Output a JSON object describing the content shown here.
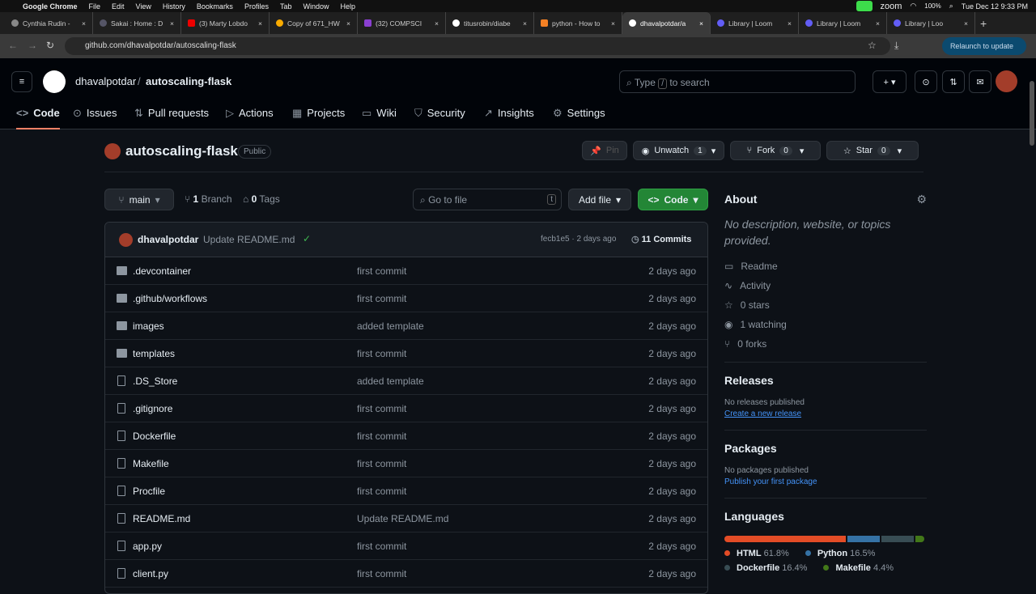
{
  "menubar": {
    "app": "Google Chrome",
    "items": [
      "File",
      "Edit",
      "View",
      "History",
      "Bookmarks",
      "Profiles",
      "Tab",
      "Window",
      "Help"
    ],
    "status": "zoom",
    "battery": "100%",
    "datetime": "Tue Dec 12  9:33 PM"
  },
  "tabs": [
    "Cynthia Rudin -",
    "Sakai : Home : D",
    "(3) Marty Lobdo",
    "Copy of 671_HW",
    "(32) COMPSCI",
    "titusrobin/diabe",
    "python - How to",
    "dhavalpotdar/a",
    "Library | Loom",
    "Library | Loom",
    "Library | Loo"
  ],
  "address": {
    "url": "github.com/dhavalpotdar/autoscaling-flask",
    "relaunch": "Relaunch to update"
  },
  "header": {
    "owner": "dhavalpotdar",
    "sep": "/",
    "repo": "autoscaling-flask",
    "search_pre": "Type",
    "search_key": "/",
    "search_post": "to search"
  },
  "nav": [
    "Code",
    "Issues",
    "Pull requests",
    "Actions",
    "Projects",
    "Wiki",
    "Security",
    "Insights",
    "Settings"
  ],
  "repo": {
    "name": "autoscaling-flask",
    "visibility": "Public",
    "pin": "Pin",
    "unwatch": "Unwatch",
    "watch_count": "1",
    "fork": "Fork",
    "fork_count": "0",
    "star": "Star",
    "star_count": "0"
  },
  "toolbar": {
    "branch": "main",
    "branches": "1",
    "branches_label": "Branch",
    "tags": "0",
    "tags_label": "Tags",
    "goto": "Go to file",
    "goto_key": "t",
    "add_file": "Add file",
    "code": "Code"
  },
  "commit": {
    "author": "dhavalpotdar",
    "message": "Update README.md",
    "hash": "fecb1e5 · 2 days ago",
    "commits": "11 Commits"
  },
  "files": [
    {
      "name": ".devcontainer",
      "type": "folder",
      "msg": "first commit",
      "date": "2 days ago"
    },
    {
      "name": ".github/workflows",
      "type": "folder",
      "msg": "first commit",
      "date": "2 days ago"
    },
    {
      "name": "images",
      "type": "folder",
      "msg": "added template",
      "date": "2 days ago"
    },
    {
      "name": "templates",
      "type": "folder",
      "msg": "first commit",
      "date": "2 days ago"
    },
    {
      "name": ".DS_Store",
      "type": "file",
      "msg": "added template",
      "date": "2 days ago"
    },
    {
      "name": ".gitignore",
      "type": "file",
      "msg": "first commit",
      "date": "2 days ago"
    },
    {
      "name": "Dockerfile",
      "type": "file",
      "msg": "first commit",
      "date": "2 days ago"
    },
    {
      "name": "Makefile",
      "type": "file",
      "msg": "first commit",
      "date": "2 days ago"
    },
    {
      "name": "Procfile",
      "type": "file",
      "msg": "first commit",
      "date": "2 days ago"
    },
    {
      "name": "README.md",
      "type": "file",
      "msg": "Update README.md",
      "date": "2 days ago"
    },
    {
      "name": "app.py",
      "type": "file",
      "msg": "first commit",
      "date": "2 days ago"
    },
    {
      "name": "client.py",
      "type": "file",
      "msg": "first commit",
      "date": "2 days ago"
    }
  ],
  "about": {
    "title": "About",
    "desc": "No description, website, or topics provided.",
    "items": [
      "Readme",
      "Activity",
      "0 stars",
      "1 watching",
      "0 forks"
    ]
  },
  "releases": {
    "title": "Releases",
    "none": "No releases published",
    "link": "Create a new release"
  },
  "packages": {
    "title": "Packages",
    "none": "No packages published",
    "link": "Publish your first package"
  },
  "languages": {
    "title": "Languages",
    "list": [
      {
        "name": "HTML",
        "pct": "61.8%",
        "value": 61.8,
        "color": "#e34c26"
      },
      {
        "name": "Python",
        "pct": "16.5%",
        "value": 16.5,
        "color": "#3572A5"
      },
      {
        "name": "Dockerfile",
        "pct": "16.4%",
        "value": 16.4,
        "color": "#384d54"
      },
      {
        "name": "Makefile",
        "pct": "4.4%",
        "value": 4.4,
        "color": "#427819"
      }
    ]
  }
}
